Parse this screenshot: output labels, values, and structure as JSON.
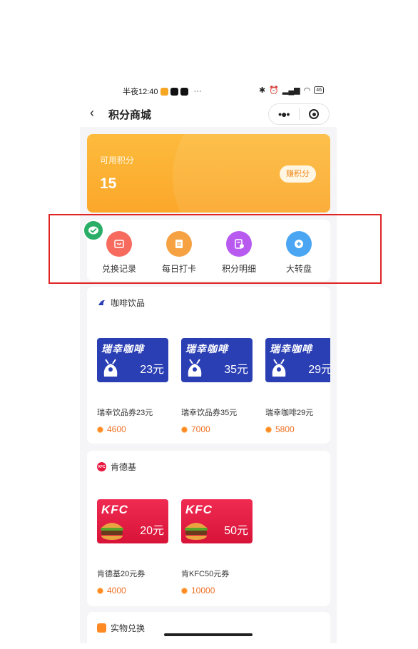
{
  "status_bar": {
    "time": "半夜12:40",
    "more": "···",
    "battery": "46"
  },
  "nav": {
    "back": "‹",
    "title": "积分商城",
    "more": "•●•"
  },
  "points": {
    "label": "可用积分",
    "value": "15",
    "earn_button": "赚积分"
  },
  "quick_menu": [
    {
      "label": "兑换记录",
      "color": "#f76b5e"
    },
    {
      "label": "每日打卡",
      "color": "#f6a142"
    },
    {
      "label": "积分明细",
      "color": "#b85af0"
    },
    {
      "label": "大转盘",
      "color": "#4aa6f2"
    }
  ],
  "sections": [
    {
      "title": "咖啡饮品",
      "products": [
        {
          "brand": "瑞幸咖啡",
          "amount": "23元",
          "name": "瑞幸饮品券23元",
          "price": "4600"
        },
        {
          "brand": "瑞幸咖啡",
          "amount": "35元",
          "name": "瑞幸饮品券35元",
          "price": "7000"
        },
        {
          "brand": "瑞幸咖啡",
          "amount": "29元",
          "name": "瑞幸咖啡29元",
          "price": "5800"
        }
      ]
    },
    {
      "title": "肯德基",
      "products": [
        {
          "brand": "KFC",
          "amount": "20元",
          "name": "肯德基20元券",
          "price": "4000"
        },
        {
          "brand": "KFC",
          "amount": "50元",
          "name": "肯KFC50元券",
          "price": "10000"
        }
      ]
    },
    {
      "title": "实物兑换"
    }
  ],
  "colors": {
    "luckin": "#2b3fb5",
    "kfc": "#e8173f",
    "accent": "#fba72a",
    "price": "#f07024"
  }
}
